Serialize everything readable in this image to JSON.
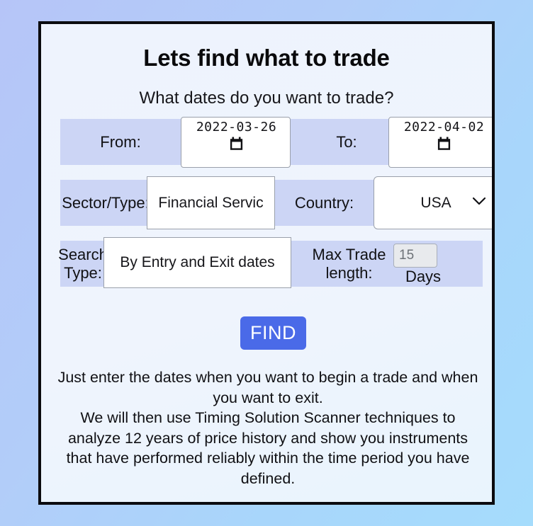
{
  "page": {
    "title": "Lets find what to trade",
    "subtitle": "What dates do you want to trade?"
  },
  "form": {
    "from": {
      "label": "From:",
      "value": "2022-03-26",
      "icon": "calendar-icon"
    },
    "to": {
      "label": "To:",
      "value": "2022-04-02",
      "icon": "calendar-icon"
    },
    "sector": {
      "label": "Sector/Type:",
      "value": "Financial Servic"
    },
    "country": {
      "label": "Country:",
      "value": "USA",
      "icon": "chevron-down-icon"
    },
    "search_type": {
      "label": "Search Type:",
      "value": "By Entry and Exit dates"
    },
    "max_trade_length": {
      "label": "Max Trade length:",
      "value": "15",
      "unit": "Days"
    },
    "submit": {
      "label": "FIND"
    }
  },
  "description": {
    "line1": "Just enter the dates when you want to begin a trade and when",
    "line2": "you want to exit.",
    "line3": "We will then use Timing Solution Scanner techniques to",
    "line4": "analyze 12 years of price history and show you instruments",
    "line5": "that have performed reliably within the time period you have",
    "line6": "defined."
  },
  "colors": {
    "accent": "#4a6ae8",
    "row_band": "#ccd5f5",
    "card_bg": "#eff4fd",
    "card_border": "#0b0b0f"
  }
}
